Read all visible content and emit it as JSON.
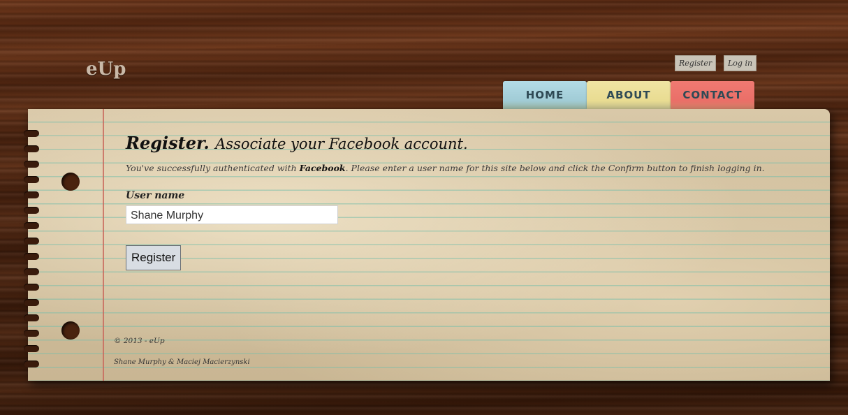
{
  "header": {
    "logo": "eUp",
    "account_links": [
      "Register",
      "Log in"
    ]
  },
  "nav": {
    "tabs": [
      {
        "label": "HOME",
        "color": "#a9d6e2"
      },
      {
        "label": "ABOUT",
        "color": "#ede08f"
      },
      {
        "label": "CONTACT",
        "color": "#ef7870"
      }
    ]
  },
  "main": {
    "title": "Register.",
    "subtitle": "Associate your Facebook account.",
    "description_before": "You've successfully authenticated with ",
    "description_provider": "Facebook",
    "description_after": ". Please enter a user name for this site below and click the Confirm button to finish logging in.",
    "user_name_label": "User name",
    "user_name_value": "Shane Murphy",
    "submit_label": "Register"
  },
  "footer": {
    "copyright": "© 2013 - eUp",
    "authors": "Shane Murphy & Maciej Macierzynski"
  }
}
